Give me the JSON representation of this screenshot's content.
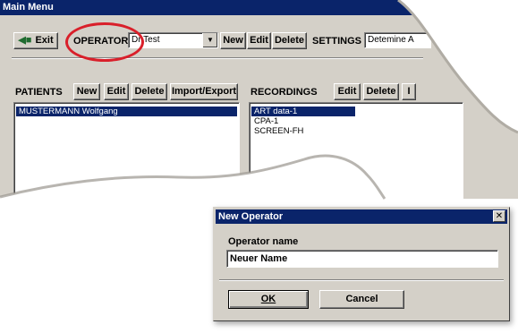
{
  "main_window": {
    "title": "Main Menu",
    "exit_label": "Exit",
    "operator_label": "OPERATOR",
    "operator_value": "Dr Test",
    "operator_new": "New",
    "operator_edit": "Edit",
    "operator_delete": "Delete",
    "settings_label": "SETTINGS",
    "settings_value": "Detemine A",
    "patients_label": "PATIENTS",
    "patients_new": "New",
    "patients_edit": "Edit",
    "patients_delete": "Delete",
    "patients_import_export": "Import/Export",
    "patients": [
      "MUSTERMANN Wolfgang"
    ],
    "recordings_label": "RECORDINGS",
    "recordings_edit": "Edit",
    "recordings_delete": "Delete",
    "recordings_more": "I",
    "recordings": [
      "ART data-1",
      "CPA-1",
      "SCREEN-FH"
    ]
  },
  "dialog": {
    "title": "New Operator",
    "close_glyph": "✕",
    "field_label": "Operator name",
    "field_value": "Neuer Name",
    "ok_label": "OK",
    "cancel_label": "Cancel"
  },
  "colors": {
    "titlebar": "#0a246a",
    "face": "#d4d0c8",
    "highlight_oval": "#d91f2a"
  }
}
